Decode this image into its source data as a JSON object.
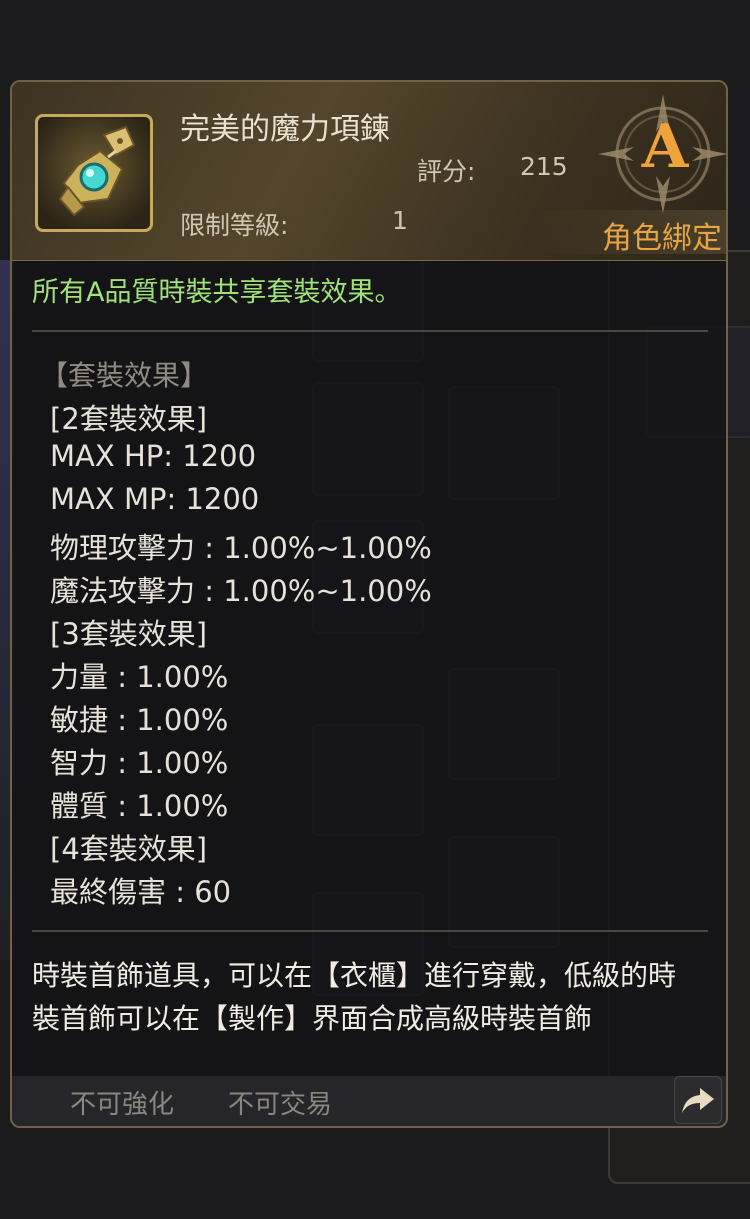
{
  "item": {
    "name": "完美的魔力項鍊",
    "score_label": "評分:",
    "score_value": "215",
    "level_label": "限制等級:",
    "level_value": "1",
    "grade": "A",
    "bind_status": "角色綁定"
  },
  "set_share_text": "所有A品質時裝共享套裝效果。",
  "set_effects": {
    "title": "【套裝效果】",
    "lines": [
      "[2套裝效果]",
      "MAX HP:  1200",
      "MAX MP:  1200",
      "物理攻擊力 : 1.00%~1.00%",
      "魔法攻擊力 : 1.00%~1.00%",
      "[3套裝效果]",
      "力量 : 1.00%",
      "敏捷 : 1.00%",
      "智力 : 1.00%",
      "體質 : 1.00%",
      "[4套裝效果]",
      "最終傷害 : 60"
    ]
  },
  "description": "時裝首飾道具，可以在【衣櫃】進行穿戴，低級的時裝首飾可以在【製作】界面合成高級時裝首飾",
  "footer": {
    "tags": [
      "不可強化",
      "不可交易"
    ],
    "share_icon": "share-arrow-icon"
  },
  "colors": {
    "set_share": "#9fe27a",
    "grade": "#f0a33a",
    "bind": "#e8a543",
    "frame_gold": "#c6a95a"
  }
}
